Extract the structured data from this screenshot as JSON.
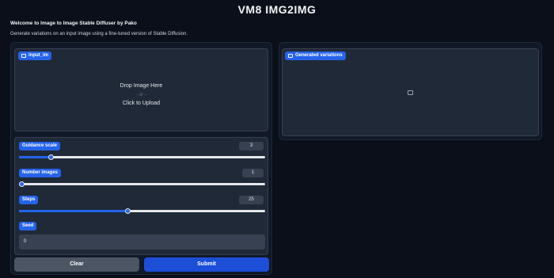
{
  "header": {
    "title": "VM8 IMG2IMG",
    "welcome": "Welcome to Image to Image Stable Diffuser by Pako",
    "description": "Generate variations on an input image using a fine-tuned version of Stable Diffusion."
  },
  "input_image": {
    "label": "input_im",
    "drop_text": "Drop Image Here",
    "or_text": "- or -",
    "click_text": "Click to Upload"
  },
  "controls": {
    "guidance": {
      "label": "Guidance scale",
      "value": "3",
      "fraction": 0.13
    },
    "number_images": {
      "label": "Number images",
      "value": "1",
      "fraction": 0.0
    },
    "steps": {
      "label": "Steps",
      "value": "25",
      "fraction": 0.44
    },
    "seed": {
      "label": "Seed",
      "value": "0"
    }
  },
  "buttons": {
    "clear": "Clear",
    "submit": "Submit"
  },
  "output": {
    "label": "Generated variations"
  },
  "colors": {
    "accent": "#2563eb",
    "background": "#0b0f19",
    "panel": "#111827",
    "box": "#1f2937"
  }
}
